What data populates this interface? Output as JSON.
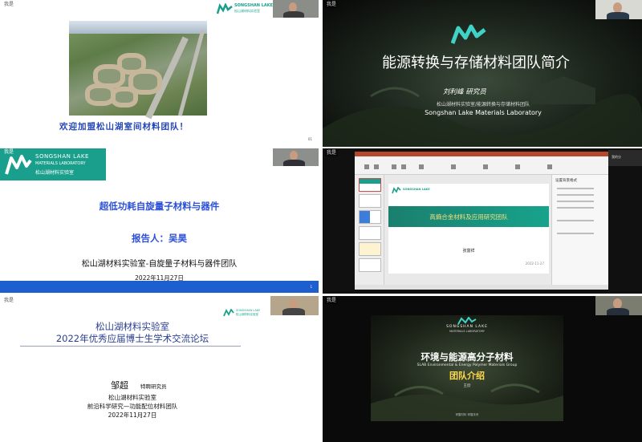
{
  "participants": [
    {
      "name": "我是"
    },
    {
      "name": "我是"
    },
    {
      "name": "我是"
    },
    {
      "name": "我是"
    },
    {
      "name": "我是"
    },
    {
      "name": "我是"
    }
  ],
  "tile1": {
    "logo_en": "SONGSHAN LAKE",
    "logo_cn": "松山湖材料实验室",
    "welcome": "欢迎加盟松山湖室间材料团队！",
    "page": "01"
  },
  "tile2": {
    "title": "能源转换与存储材料团队简介",
    "author": "刘利峰   研究员",
    "lab_line": "松山湖材料实验室/能源转换与存储材料团队",
    "lab_en": "Songshan Lake Materials Laboratory"
  },
  "tile3": {
    "logo_en1": "SONGSHAN LAKE",
    "logo_en2": "MATERIALS LABORATORY",
    "logo_cn": "松山湖材料实验室",
    "title": "超低功耗自旋量子材料与器件",
    "reporter": "报告人：吴昊",
    "org": "松山湖材料实验室-自旋量子材料与器件团队",
    "date": "2022年11月27日",
    "page": "1"
  },
  "tile4": {
    "logo": "SONGSHAN LAKE",
    "slide_title": "高熵合金材料及应用研究团队",
    "slide_author": "张富祥",
    "slide_date": "2022-11-27",
    "pane_title": "设置背景格式",
    "cam_label": "我的分"
  },
  "tile5": {
    "logo_en": "SONGSHAN LAKE",
    "logo_cn": "松山湖材料实验室",
    "title1": "松山湖材料实验室",
    "title2": "2022年优秀应届博士生学术交流论坛",
    "speaker": "邹超",
    "speaker_title": "特聘研究员",
    "line1": "松山湖材料实验室",
    "line2": "前沿科学研究—功能配位材料团队",
    "line3": "2022年11月27日"
  },
  "tile6": {
    "logo_en": "SONGSHAN LAKE",
    "logo_sub": "MATERIALS LABORATORY",
    "title": "环境与能源高分子材料",
    "subtitle": "SLAB Environmental & Energy Polymer Materials Group",
    "big": "团队介绍",
    "name": "王欣",
    "foot": "掌握材料 掌握未来"
  },
  "colors": {
    "brand_teal": "#1a9f8c",
    "title_blue": "#2b4fd8",
    "ppt_red": "#b7472a",
    "gold": "#ffd84a"
  }
}
